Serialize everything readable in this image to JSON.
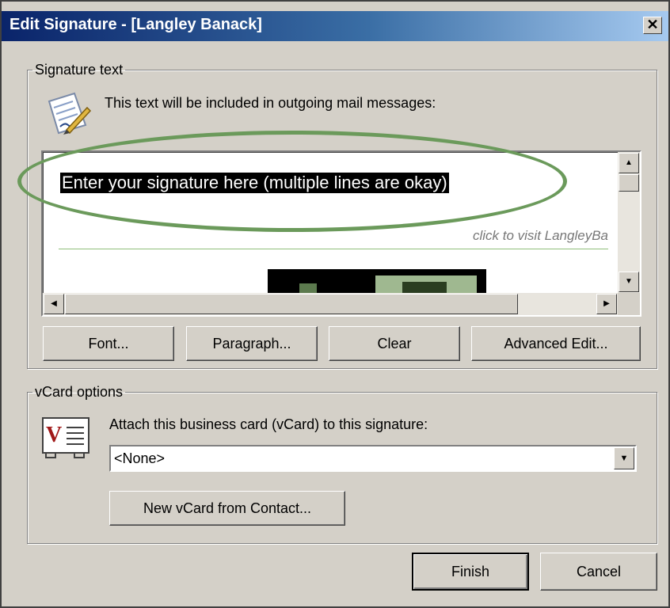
{
  "window": {
    "title": "Edit Signature - [Langley Banack]",
    "close_glyph": "✕"
  },
  "signature_group": {
    "legend": "Signature text",
    "icon": "signature-pen-icon",
    "description": "This text will be included in outgoing mail messages:",
    "editor": {
      "selected_text": "Enter your signature here (multiple lines are okay)",
      "link_text": "click to visit LangleyBa"
    },
    "buttons": {
      "font": "Font...",
      "paragraph": "Paragraph...",
      "clear": "Clear",
      "advanced_edit": "Advanced Edit..."
    }
  },
  "vcard_group": {
    "legend": "vCard options",
    "icon": "vcard-icon",
    "description": "Attach this business card (vCard) to this signature:",
    "select": {
      "value": "<None>"
    },
    "new_vcard_button": "New vCard from Contact..."
  },
  "footer": {
    "finish": "Finish",
    "cancel": "Cancel"
  },
  "colors": {
    "annotation_ellipse": "#6b9a5b",
    "titlebar_start": "#0a246a",
    "titlebar_end": "#a6caf0",
    "dialog_face": "#d4d0c8"
  }
}
